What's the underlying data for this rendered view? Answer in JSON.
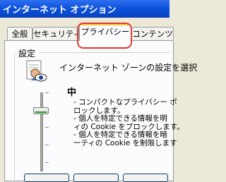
{
  "window": {
    "title": "インターネット オプション"
  },
  "tabs": [
    {
      "label": "全般"
    },
    {
      "label": "セキュリティ"
    },
    {
      "label": "プライバシー"
    },
    {
      "label": "コンテンツ"
    }
  ],
  "settings": {
    "group_label": "設定",
    "intro": "インターネット ゾーンの設定を選択",
    "level": "中",
    "slider_level_fraction": 0.4,
    "description_lines": [
      "- コンパクトなプライバシー ポ",
      "ロックします。",
      "- 個人を特定できる情報を明",
      "ィの Cookie をブロックします。",
      "- 個人を特定できる情報を暗",
      "ーティの Cookie を制限します"
    ]
  },
  "colors": {
    "highlight": "#e23a2b",
    "titlebar": "#0a4fd8",
    "active_tab_accent": "#ffc83c"
  }
}
